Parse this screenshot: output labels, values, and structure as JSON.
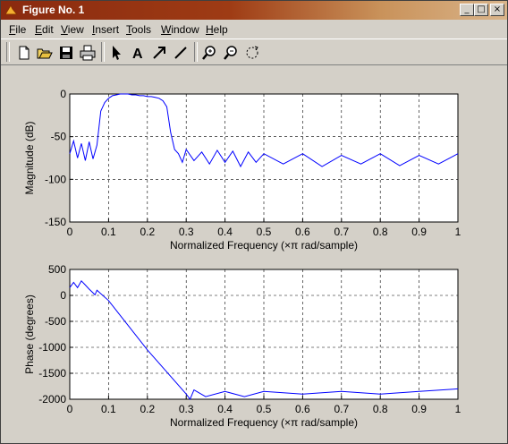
{
  "window": {
    "title": "Figure No. 1"
  },
  "title_buttons": {
    "minimize": "_",
    "maximize": "□",
    "close": "×"
  },
  "menu": [
    {
      "label": "File",
      "key": "F"
    },
    {
      "label": "Edit",
      "key": "E"
    },
    {
      "label": "View",
      "key": "V"
    },
    {
      "label": "Insert",
      "key": "I"
    },
    {
      "label": "Tools",
      "key": "T"
    },
    {
      "label": "Window",
      "key": "W"
    },
    {
      "label": "Help",
      "key": "H"
    }
  ],
  "toolbar": {
    "icons": [
      "new-file-icon",
      "open-folder-icon",
      "save-icon",
      "print-icon",
      "arrow-select-icon",
      "text-insert-icon",
      "arrow-insert-icon",
      "line-insert-icon",
      "zoom-in-icon",
      "zoom-out-icon",
      "rotate-icon"
    ],
    "text_tool_label": "A"
  },
  "colors": {
    "plot_line": "#0000ff",
    "background": "#d4d0c8",
    "axes": "#ffffff"
  },
  "chart_data": [
    {
      "type": "line",
      "xlabel": "Normalized Frequency  (×π rad/sample)",
      "ylabel": "Magnitude (dB)",
      "xlim": [
        0,
        1
      ],
      "ylim": [
        -150,
        0
      ],
      "xticks": [
        "0",
        "0.1",
        "0.2",
        "0.3",
        "0.4",
        "0.5",
        "0.6",
        "0.7",
        "0.8",
        "0.9",
        "1"
      ],
      "yticks": [
        "0",
        "-50",
        "-100",
        "-150"
      ],
      "grid": true,
      "series": [
        {
          "x": [
            0,
            0.01,
            0.02,
            0.03,
            0.04,
            0.05,
            0.06,
            0.07,
            0.08,
            0.09,
            0.1,
            0.11,
            0.12,
            0.13,
            0.14,
            0.15,
            0.16,
            0.17,
            0.18,
            0.19,
            0.2,
            0.21,
            0.22,
            0.23,
            0.24,
            0.25,
            0.26,
            0.27,
            0.28,
            0.29,
            0.3,
            0.32,
            0.34,
            0.36,
            0.38,
            0.4,
            0.42,
            0.44,
            0.46,
            0.48,
            0.5,
            0.55,
            0.6,
            0.65,
            0.7,
            0.75,
            0.8,
            0.85,
            0.9,
            0.95,
            1
          ],
          "y": [
            -70,
            -55,
            -75,
            -58,
            -78,
            -56,
            -76,
            -60,
            -20,
            -10,
            -5,
            -2,
            -1,
            0,
            0,
            0,
            -1,
            -1,
            -2,
            -2,
            -3,
            -3,
            -4,
            -5,
            -8,
            -15,
            -45,
            -65,
            -70,
            -80,
            -65,
            -78,
            -68,
            -82,
            -66,
            -80,
            -67,
            -85,
            -68,
            -80,
            -70,
            -82,
            -70,
            -85,
            -72,
            -82,
            -70,
            -84,
            -72,
            -82,
            -70
          ]
        }
      ]
    },
    {
      "type": "line",
      "xlabel": "Normalized Frequency  (×π rad/sample)",
      "ylabel": "Phase (degrees)",
      "xlim": [
        0,
        1
      ],
      "ylim": [
        -2000,
        500
      ],
      "xticks": [
        "0",
        "0.1",
        "0.2",
        "0.3",
        "0.4",
        "0.5",
        "0.6",
        "0.7",
        "0.8",
        "0.9",
        "1"
      ],
      "yticks": [
        "500",
        "0",
        "-500",
        "-1000",
        "-1500",
        "-2000"
      ],
      "grid": true,
      "series": [
        {
          "x": [
            0,
            0.01,
            0.02,
            0.03,
            0.04,
            0.05,
            0.06,
            0.065,
            0.07,
            0.1,
            0.2,
            0.3,
            0.31,
            0.32,
            0.35,
            0.4,
            0.45,
            0.5,
            0.6,
            0.7,
            0.8,
            0.9,
            1
          ],
          "y": [
            150,
            250,
            150,
            280,
            200,
            120,
            50,
            10,
            100,
            -100,
            -1050,
            -1900,
            -2000,
            -1820,
            -1950,
            -1850,
            -1950,
            -1850,
            -1900,
            -1850,
            -1900,
            -1850,
            -1800
          ]
        }
      ]
    }
  ]
}
